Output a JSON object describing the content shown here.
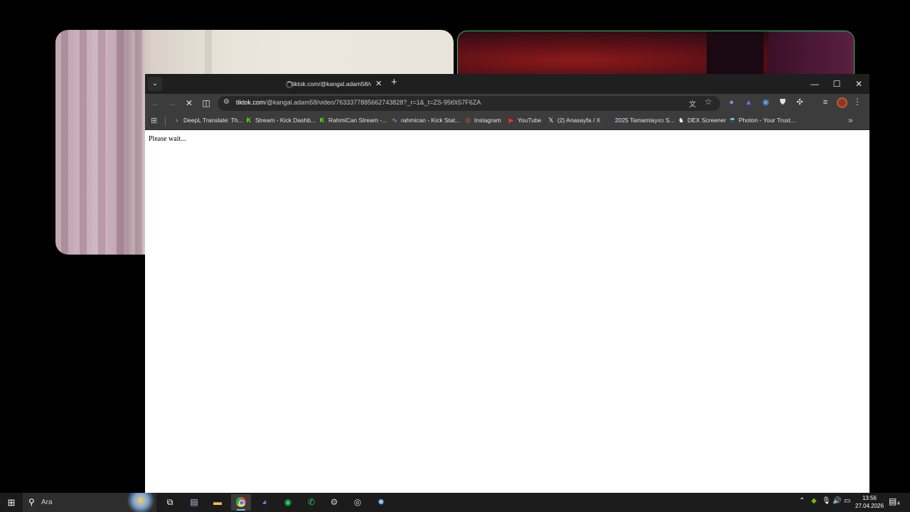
{
  "browser": {
    "tab": {
      "title": "tiktok.com/@kangal.adam58/v"
    },
    "address_bar": {
      "domain": "tiktok.com",
      "path": "/@kangal.adam58/video/7633377885662743828?_r=1&_t=ZS-95t0iS7F6ZA"
    },
    "bookmarks": [
      {
        "label": "DeepL Translate: Th...",
        "icon": "deepl-icon"
      },
      {
        "label": "Stream - Kick Dashb...",
        "icon": "kick-icon"
      },
      {
        "label": "RahmiCan Stream -...",
        "icon": "kick-icon"
      },
      {
        "label": "rahmican - Kick Stat...",
        "icon": "kickstats-icon"
      },
      {
        "label": "Instagram",
        "icon": "instagram-icon"
      },
      {
        "label": "YouTube",
        "icon": "youtube-icon"
      },
      {
        "label": "(2) Anasayfa / X",
        "icon": "x-icon"
      },
      {
        "label": "2025 Tamamlayıcı S...",
        "icon": "globe-icon"
      },
      {
        "label": "DEX Screener",
        "icon": "dexscreener-icon"
      },
      {
        "label": "Photon - Your Trust...",
        "icon": "photon-icon"
      }
    ]
  },
  "page": {
    "text": "Please wait..."
  },
  "taskbar": {
    "search_placeholder": "Ara",
    "clock": {
      "time": "13:56",
      "date": "27.04.2026"
    },
    "notification_count": "4"
  }
}
